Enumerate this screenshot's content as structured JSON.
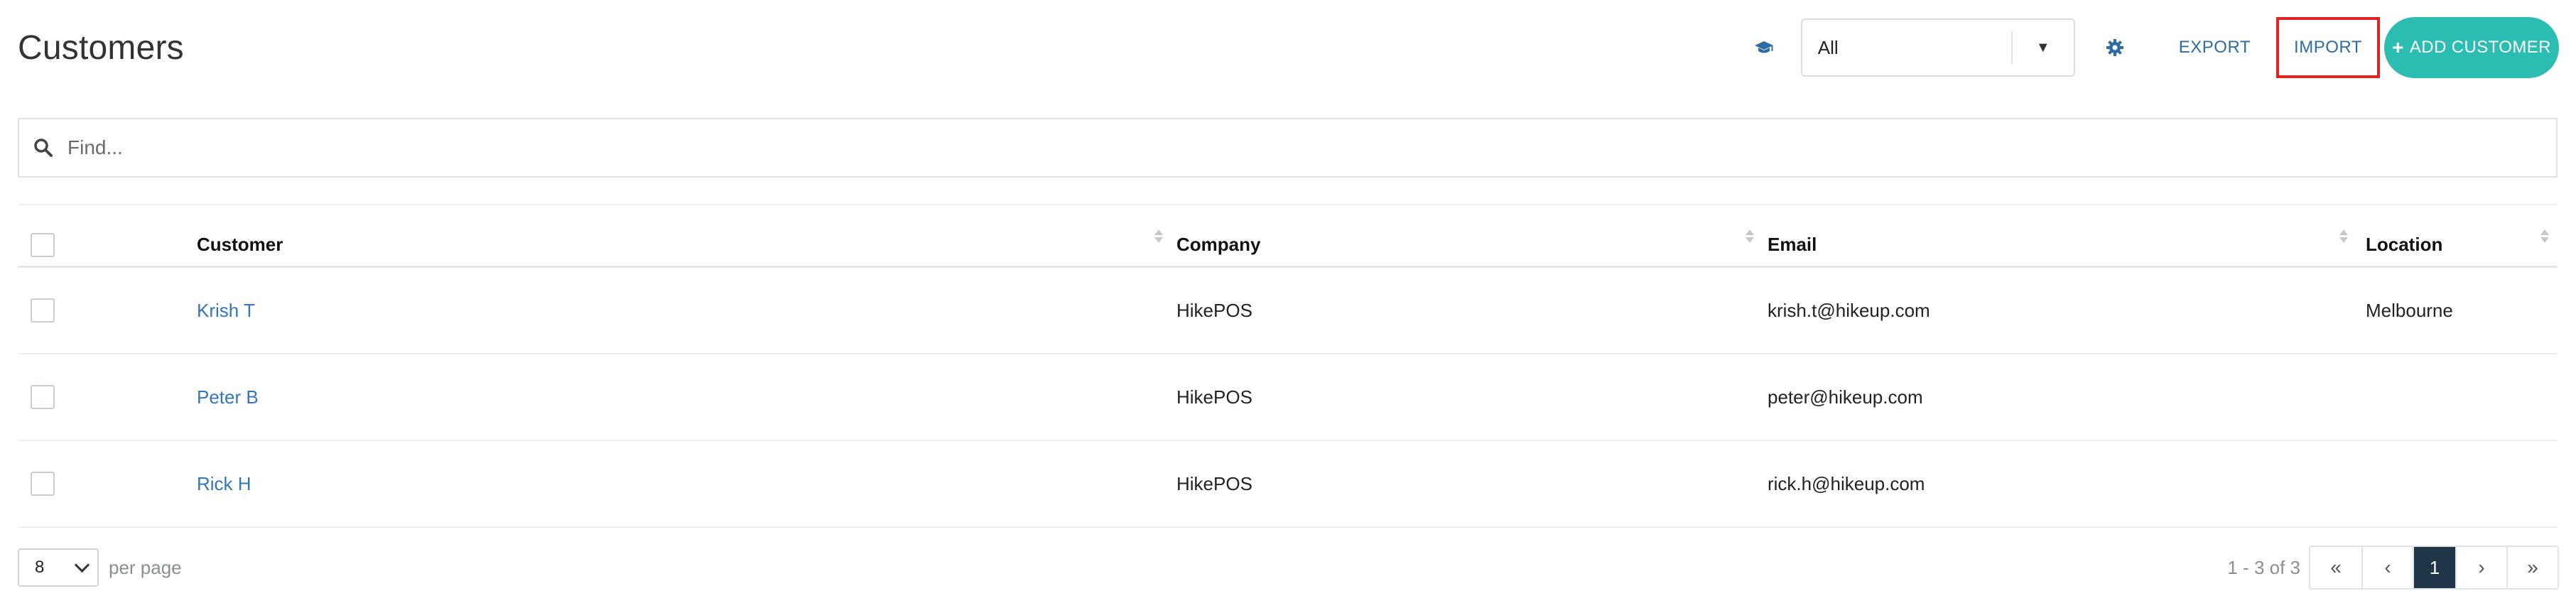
{
  "page": {
    "title": "Customers"
  },
  "toolbar": {
    "filter_value": "All",
    "export_label": "EXPORT",
    "import_label": "IMPORT",
    "add_customer_label": "ADD CUSTOMER",
    "accent_color": "#2bbcb2",
    "link_color": "#2e6da4",
    "highlight_color": "#e02424"
  },
  "search": {
    "placeholder": "Find..."
  },
  "table": {
    "headers": {
      "customer": "Customer",
      "company": "Company",
      "email": "Email",
      "location": "Location"
    },
    "rows": [
      {
        "customer": "Krish T",
        "company": "HikePOS",
        "email": "krish.t@hikeup.com",
        "location": "Melbourne"
      },
      {
        "customer": "Peter B",
        "company": "HikePOS",
        "email": "peter@hikeup.com",
        "location": ""
      },
      {
        "customer": "Rick H",
        "company": "HikePOS",
        "email": "rick.h@hikeup.com",
        "location": ""
      }
    ]
  },
  "footer": {
    "per_page_value": "8",
    "per_page_label": "per page",
    "range_text": "1 - 3 of 3",
    "pager": {
      "first": "«",
      "prev": "‹",
      "current": "1",
      "next": "›",
      "last": "»"
    }
  }
}
